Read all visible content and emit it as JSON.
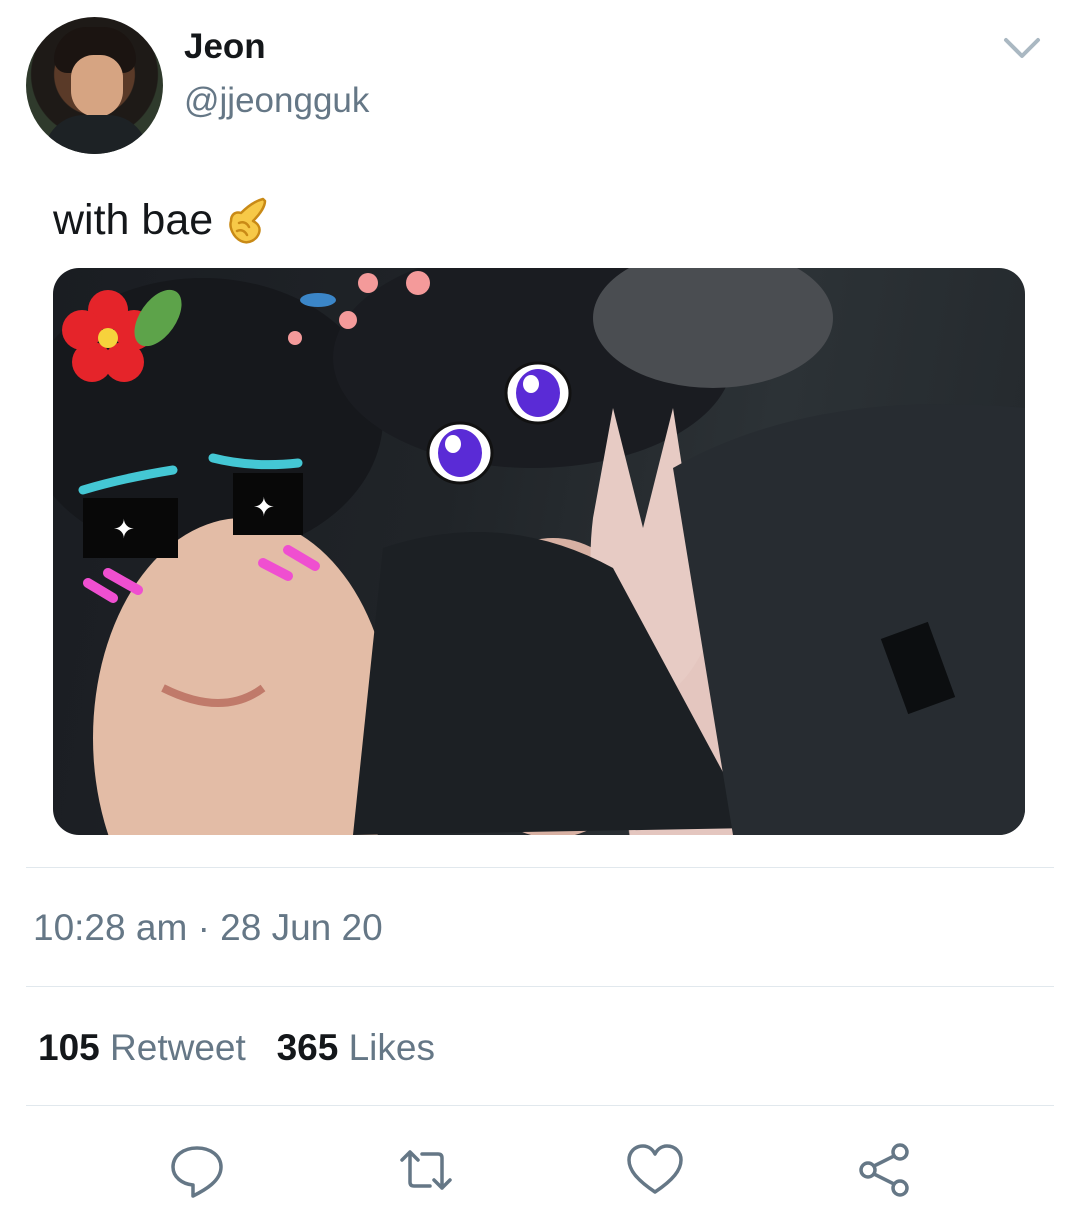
{
  "user": {
    "display_name": "Jeon",
    "handle": "@jjeongguk"
  },
  "tweet": {
    "text": "with bae",
    "emoji": "backhand-index-pointing-left"
  },
  "meta": {
    "time": "10:28 am",
    "separator": "·",
    "date": "28 Jun 20"
  },
  "stats": {
    "retweets_count": "105",
    "retweets_label": "Retweet",
    "likes_count": "365",
    "likes_label": "Likes"
  },
  "actions": [
    "reply-icon",
    "retweet-icon",
    "like-icon",
    "share-icon"
  ],
  "colors": {
    "text_primary": "#14171a",
    "text_secondary": "#657786",
    "divider": "#e1e8ed",
    "icon": "#657786"
  }
}
